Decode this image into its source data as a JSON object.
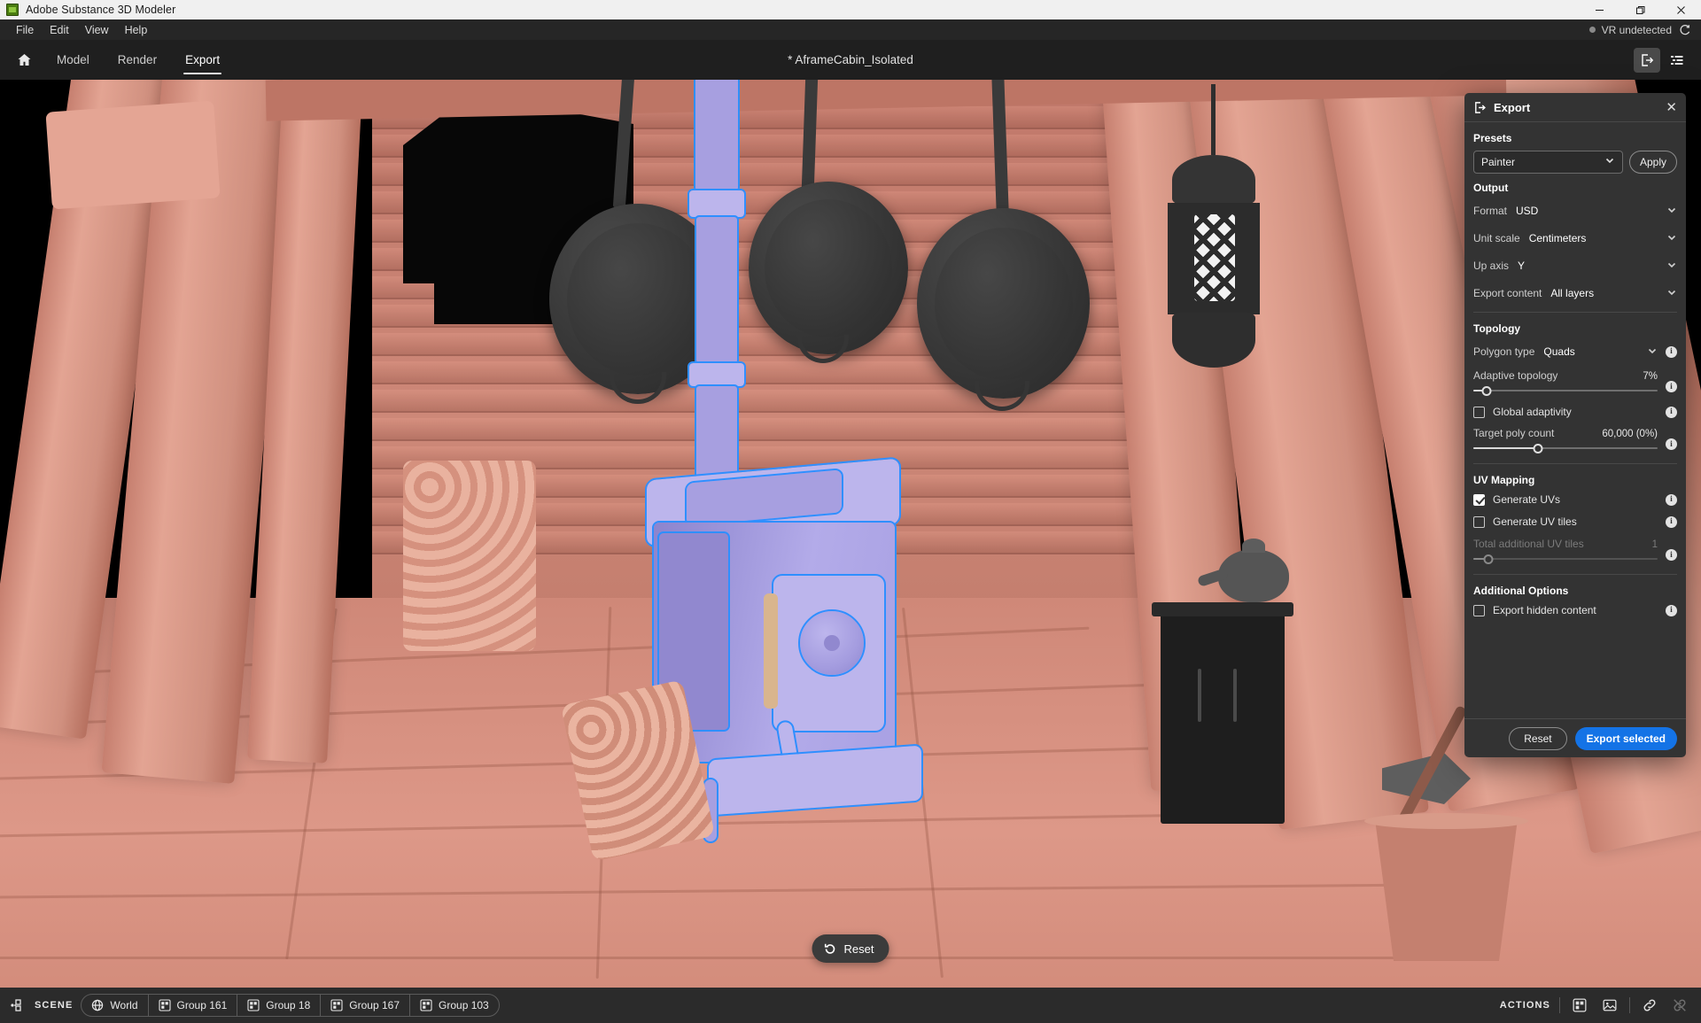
{
  "window": {
    "app_title": "Adobe Substance 3D Modeler",
    "logo_icon": "substance-modeler-logo",
    "controls": [
      {
        "name": "minimize",
        "icon": "minimize-icon"
      },
      {
        "name": "restore",
        "icon": "restore-icon"
      },
      {
        "name": "close",
        "icon": "close-icon"
      }
    ]
  },
  "menubar": {
    "items": [
      {
        "label": "File"
      },
      {
        "label": "Edit"
      },
      {
        "label": "View"
      },
      {
        "label": "Help"
      }
    ],
    "vr_status": "VR undetected",
    "vr_refresh_icon": "refresh-icon"
  },
  "tabbar": {
    "home_icon": "home-icon",
    "tabs": [
      {
        "label": "Model",
        "active": false
      },
      {
        "label": "Render",
        "active": false
      },
      {
        "label": "Export",
        "active": true
      }
    ],
    "document_title": "*  AframeCabin_Isolated",
    "right_icons": [
      {
        "name": "export-panel-toggle",
        "icon": "export-icon",
        "active": true
      },
      {
        "name": "layers-panel-toggle",
        "icon": "list-icon",
        "active": false
      }
    ]
  },
  "viewport": {
    "reset_button": "Reset",
    "reset_icon": "rotate-ccw-icon",
    "background_color": "#000000",
    "clay_color": "#d8907f",
    "selection_color": "#a79fe0",
    "selection_outline_color": "#2f8fff"
  },
  "export_panel": {
    "title": "Export",
    "header_icon": "export-icon",
    "close_icon": "close-icon",
    "presets": {
      "section_title": "Presets",
      "selected": "Painter",
      "chevron_icon": "chevron-down-icon",
      "apply_label": "Apply"
    },
    "output": {
      "section_title": "Output",
      "rows": [
        {
          "label": "Format",
          "value": "USD"
        },
        {
          "label": "Unit scale",
          "value": "Centimeters"
        },
        {
          "label": "Up axis",
          "value": "Y"
        },
        {
          "label": "Export content",
          "value": "All layers"
        }
      ]
    },
    "topology": {
      "section_title": "Topology",
      "polygon_type": {
        "label": "Polygon type",
        "value": "Quads"
      },
      "adaptive_topology": {
        "label": "Adaptive topology",
        "value": "7%",
        "percent": 7
      },
      "global_adaptivity": {
        "label": "Global adaptivity",
        "checked": false
      },
      "target_poly_count": {
        "label": "Target poly count",
        "value": "60,000 (0%)",
        "percent": 35
      }
    },
    "uv_mapping": {
      "section_title": "UV Mapping",
      "generate_uvs": {
        "label": "Generate UVs",
        "checked": true
      },
      "generate_uv_tiles": {
        "label": "Generate UV tiles",
        "checked": false
      },
      "total_additional_uv_tiles": {
        "label": "Total additional UV tiles",
        "value": "1",
        "percent": 8,
        "disabled": true
      }
    },
    "additional_options": {
      "section_title": "Additional Options",
      "export_hidden_content": {
        "label": "Export hidden content",
        "checked": false
      }
    },
    "footer": {
      "reset_label": "Reset",
      "export_label": "Export selected",
      "accent_color": "#1473e6"
    },
    "info_glyph": "i"
  },
  "statusbar": {
    "scene_icon": "scene-icon",
    "scene_label": "SCENE",
    "breadcrumbs": [
      {
        "label": "World",
        "icon": "globe-icon"
      },
      {
        "label": "Group 161",
        "icon": "group-icon"
      },
      {
        "label": "Group 18",
        "icon": "group-icon"
      },
      {
        "label": "Group 167",
        "icon": "group-icon"
      },
      {
        "label": "Group 103",
        "icon": "group-icon"
      }
    ],
    "actions_label": "ACTIONS",
    "action_icons": [
      {
        "name": "group-action",
        "icon": "group-icon",
        "enabled": true
      },
      {
        "name": "image-action",
        "icon": "image-icon",
        "enabled": true
      },
      {
        "name": "link-action",
        "icon": "link-icon",
        "enabled": true
      },
      {
        "name": "unlink-action",
        "icon": "unlink-icon",
        "enabled": false
      }
    ]
  }
}
